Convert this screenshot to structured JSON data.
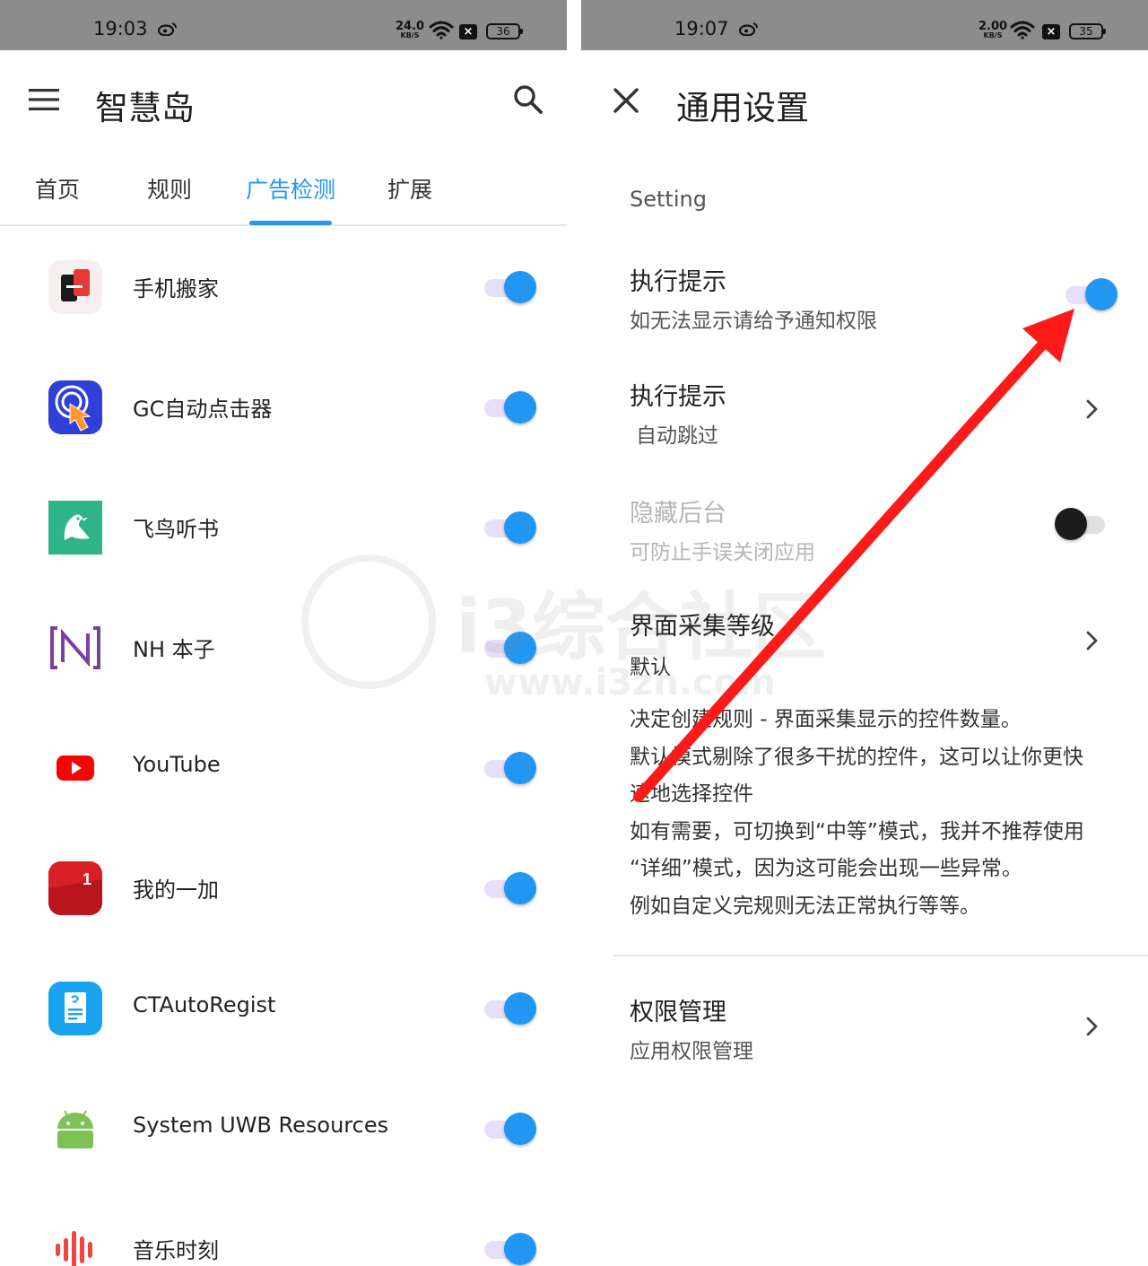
{
  "left_screen": {
    "status_bar": {
      "time": "19:03",
      "net_speed": "24.0",
      "net_unit": "KB/S",
      "battery": "36"
    },
    "toolbar": {
      "menu_icon": "menu-icon",
      "title": "智慧岛",
      "search_icon": "search-icon"
    },
    "tabs": [
      {
        "label": "首页",
        "active": false
      },
      {
        "label": "规则",
        "active": false
      },
      {
        "label": "广告检测",
        "active": true
      },
      {
        "label": "扩展",
        "active": false
      }
    ],
    "apps": [
      {
        "name": "手机搬家",
        "enabled": true
      },
      {
        "name": "GC自动点击器",
        "enabled": true
      },
      {
        "name": "飞鸟听书",
        "enabled": true
      },
      {
        "name": "NH 本子",
        "enabled": true
      },
      {
        "name": "YouTube",
        "enabled": true
      },
      {
        "name": "我的一加",
        "enabled": true
      },
      {
        "name": "CTAutoRegist",
        "enabled": true
      },
      {
        "name": "System UWB Resources",
        "enabled": true
      },
      {
        "name": "音乐时刻",
        "enabled": true
      }
    ]
  },
  "right_screen": {
    "status_bar": {
      "time": "19:07",
      "net_speed": "2.00",
      "net_unit": "KB/S",
      "battery": "35"
    },
    "toolbar": {
      "close_icon": "close-icon",
      "title": "通用设置"
    },
    "section_header": "Setting",
    "prefs": {
      "exec_notice": {
        "title": "执行提示",
        "subtitle": "如无法显示请给予通知权限",
        "enabled": true
      },
      "exec_notice_skip": {
        "title": "执行提示",
        "subtitle": "自动跳过"
      },
      "hide_background": {
        "title": "隐藏后台",
        "subtitle": "可防止手误关闭应用",
        "enabled": false
      },
      "capture_level": {
        "title": "界面采集等级",
        "subtitle": "默认",
        "description": [
          "决定创建规则 - 界面采集显示的控件数量。",
          "默认模式剔除了很多干扰的控件，这可以让你更快",
          "速地选择控件",
          "如有需要，可切换到“中等”模式，我并不推荐使用",
          "“详细”模式，因为这可能会出现一些异常。",
          "例如自定义完规则无法正常执行等等。"
        ]
      },
      "permissions": {
        "title": "权限管理",
        "subtitle": "应用权限管理"
      }
    }
  },
  "watermark": {
    "text": "i3综合社区",
    "url": "www.i3zh.com"
  },
  "colors": {
    "accent": "#2196f3",
    "switch_track_on": "#e7defa",
    "annotation_arrow": "#ff1a1a",
    "status_bar": "#8c8c8c"
  }
}
